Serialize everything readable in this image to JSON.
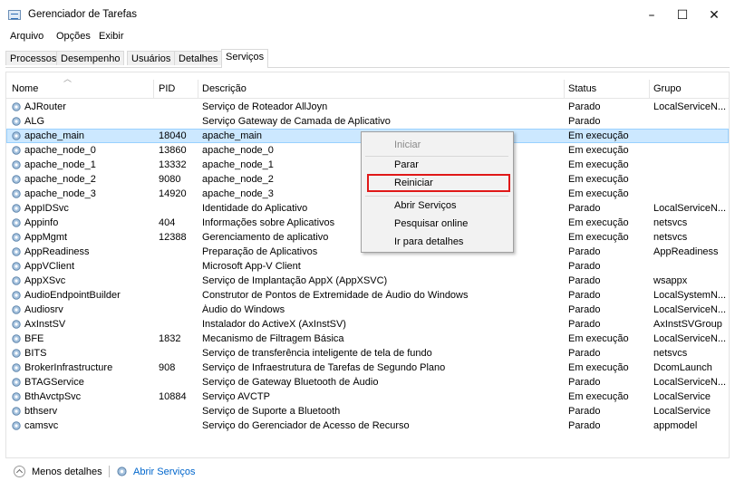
{
  "window": {
    "title": "Gerenciador de Tarefas"
  },
  "menu": [
    "Arquivo",
    "Opções",
    "Exibir"
  ],
  "tabs": [
    "Processos",
    "Desempenho",
    "Usuários",
    "Detalhes",
    "Serviços"
  ],
  "active_tab": "Serviços",
  "columns": {
    "name": "Nome",
    "pid": "PID",
    "desc": "Descrição",
    "status": "Status",
    "group": "Grupo"
  },
  "rows": [
    {
      "name": "AJRouter",
      "pid": "",
      "desc": "Serviço de Roteador AllJoyn",
      "status": "Parado",
      "group": "LocalServiceN..."
    },
    {
      "name": "ALG",
      "pid": "",
      "desc": "Serviço Gateway de Camada de Aplicativo",
      "status": "Parado",
      "group": ""
    },
    {
      "name": "apache_main",
      "pid": "18040",
      "desc": "apache_main",
      "status": "Em execução",
      "group": "",
      "selected": true
    },
    {
      "name": "apache_node_0",
      "pid": "13860",
      "desc": "apache_node_0",
      "status": "Em execução",
      "group": ""
    },
    {
      "name": "apache_node_1",
      "pid": "13332",
      "desc": "apache_node_1",
      "status": "Em execução",
      "group": ""
    },
    {
      "name": "apache_node_2",
      "pid": "9080",
      "desc": "apache_node_2",
      "status": "Em execução",
      "group": ""
    },
    {
      "name": "apache_node_3",
      "pid": "14920",
      "desc": "apache_node_3",
      "status": "Em execução",
      "group": ""
    },
    {
      "name": "AppIDSvc",
      "pid": "",
      "desc": "Identidade do Aplicativo",
      "status": "Parado",
      "group": "LocalServiceN..."
    },
    {
      "name": "Appinfo",
      "pid": "404",
      "desc": "Informações sobre Aplicativos",
      "status": "Em execução",
      "group": "netsvcs"
    },
    {
      "name": "AppMgmt",
      "pid": "12388",
      "desc": "Gerenciamento de aplicativo",
      "status": "Em execução",
      "group": "netsvcs"
    },
    {
      "name": "AppReadiness",
      "pid": "",
      "desc": "Preparação de Aplicativos",
      "status": "Parado",
      "group": "AppReadiness"
    },
    {
      "name": "AppVClient",
      "pid": "",
      "desc": "Microsoft App-V Client",
      "status": "Parado",
      "group": ""
    },
    {
      "name": "AppXSvc",
      "pid": "",
      "desc": "Serviço de Implantação AppX (AppXSVC)",
      "status": "Parado",
      "group": "wsappx"
    },
    {
      "name": "AudioEndpointBuilder",
      "pid": "",
      "desc": "Construtor de Pontos de Extremidade de Áudio do Windows",
      "status": "Parado",
      "group": "LocalSystemN..."
    },
    {
      "name": "Audiosrv",
      "pid": "",
      "desc": "Áudio do Windows",
      "status": "Parado",
      "group": "LocalServiceN..."
    },
    {
      "name": "AxInstSV",
      "pid": "",
      "desc": "Instalador do ActiveX (AxInstSV)",
      "status": "Parado",
      "group": "AxInstSVGroup"
    },
    {
      "name": "BFE",
      "pid": "1832",
      "desc": "Mecanismo de Filtragem Básica",
      "status": "Em execução",
      "group": "LocalServiceN..."
    },
    {
      "name": "BITS",
      "pid": "",
      "desc": "Serviço de transferência inteligente de tela de fundo",
      "status": "Parado",
      "group": "netsvcs"
    },
    {
      "name": "BrokerInfrastructure",
      "pid": "908",
      "desc": "Serviço de Infraestrutura de Tarefas de Segundo Plano",
      "status": "Em execução",
      "group": "DcomLaunch"
    },
    {
      "name": "BTAGService",
      "pid": "",
      "desc": "Serviço de Gateway Bluetooth de Áudio",
      "status": "Parado",
      "group": "LocalServiceN..."
    },
    {
      "name": "BthAvctpSvc",
      "pid": "10884",
      "desc": "Serviço AVCTP",
      "status": "Em execução",
      "group": "LocalService"
    },
    {
      "name": "bthserv",
      "pid": "",
      "desc": "Serviço de Suporte a Bluetooth",
      "status": "Parado",
      "group": "LocalService"
    },
    {
      "name": "camsvc",
      "pid": "",
      "desc": "Serviço do Gerenciador de Acesso de Recurso",
      "status": "Parado",
      "group": "appmodel"
    }
  ],
  "context_menu": {
    "items": [
      {
        "label": "Iniciar",
        "disabled": true
      },
      {
        "label": "Parar",
        "disabled": false
      },
      {
        "label": "Reiniciar",
        "disabled": false,
        "highlighted": true
      },
      {
        "label": "Abrir Serviços",
        "disabled": false
      },
      {
        "label": "Pesquisar online",
        "disabled": false
      },
      {
        "label": "Ir para detalhes",
        "disabled": false
      }
    ],
    "highlight_color": "#e01818"
  },
  "footer": {
    "less_details": "Menos detalhes",
    "open_services": "Abrir Serviços"
  },
  "colors": {
    "selection": "#cce8ff",
    "link": "#0066cc"
  }
}
